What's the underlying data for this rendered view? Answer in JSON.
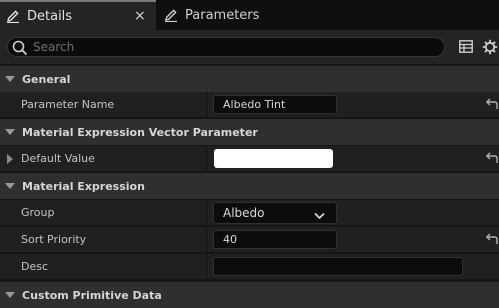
{
  "tabs": [
    {
      "label": "Details",
      "icon": "pencil-icon",
      "active": true,
      "close": "×"
    },
    {
      "label": "Parameters",
      "icon": "pencil-icon",
      "active": false
    }
  ],
  "search": {
    "placeholder": "Search",
    "value": ""
  },
  "toolbar": {
    "icons": [
      "table-icon",
      "settings-icon"
    ]
  },
  "categories": [
    {
      "label": "General",
      "rows": [
        {
          "label": "Parameter Name",
          "value": "Albedo Tint",
          "reset_icon": "reset-arrow-icon"
        }
      ]
    },
    {
      "label": "Material Expression Vector Parameter",
      "rows": [
        {
          "label": "Default Value",
          "color": "#ffffff",
          "reset_icon": "reset-arrow-icon"
        }
      ]
    },
    {
      "label": "Material Expression",
      "rows": [
        {
          "label": "Group",
          "value": "Albedo"
        },
        {
          "label": "Sort Priority",
          "value": "40",
          "reset_icon": "reset-arrow-icon"
        },
        {
          "label": "Desc",
          "value": ""
        }
      ]
    },
    {
      "label": "Custom Primitive Data",
      "rows": []
    }
  ]
}
